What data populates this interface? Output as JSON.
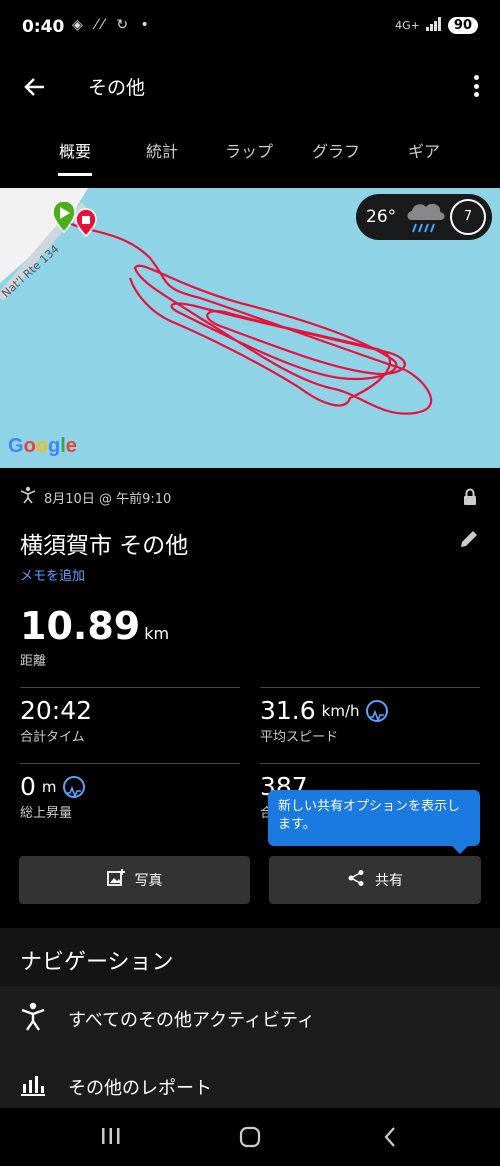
{
  "status": {
    "time": "0:40",
    "net": "4G+",
    "battery": "90"
  },
  "appbar": {
    "title": "その他"
  },
  "tabs": [
    "概要",
    "統計",
    "ラップ",
    "グラフ",
    "ギア"
  ],
  "map": {
    "road_label": "Nat'l Rte 134",
    "weather_temp": "26°",
    "wind_speed": "7",
    "attribution": "Google"
  },
  "activity": {
    "meta": "8月10日 @ 午前9:10",
    "title": "横須賀市 その他",
    "add_memo": "メモを追加",
    "distance_value": "10.89",
    "distance_unit": "km",
    "distance_label": "距離"
  },
  "stats": [
    {
      "value": "20:42",
      "unit": "",
      "label": "合計タイム"
    },
    {
      "value": "31.6",
      "unit": "km/h",
      "label": "平均スピード"
    },
    {
      "value": "0",
      "unit": "m",
      "label": "総上昇量"
    },
    {
      "value": "387",
      "unit": "",
      "label": "合"
    }
  ],
  "tooltip": "新しい共有オプションを表示します。",
  "buttons": {
    "photo": "写真",
    "share": "共有"
  },
  "navigation": {
    "header": "ナビゲーション",
    "items": [
      "すべてのその他アクティビティ",
      "その他のレポート"
    ]
  },
  "colors": {
    "accent": "#5aa3ff",
    "track": "#e8113c",
    "water": "#8fd3e6",
    "tooltip": "#1a7ae0"
  }
}
